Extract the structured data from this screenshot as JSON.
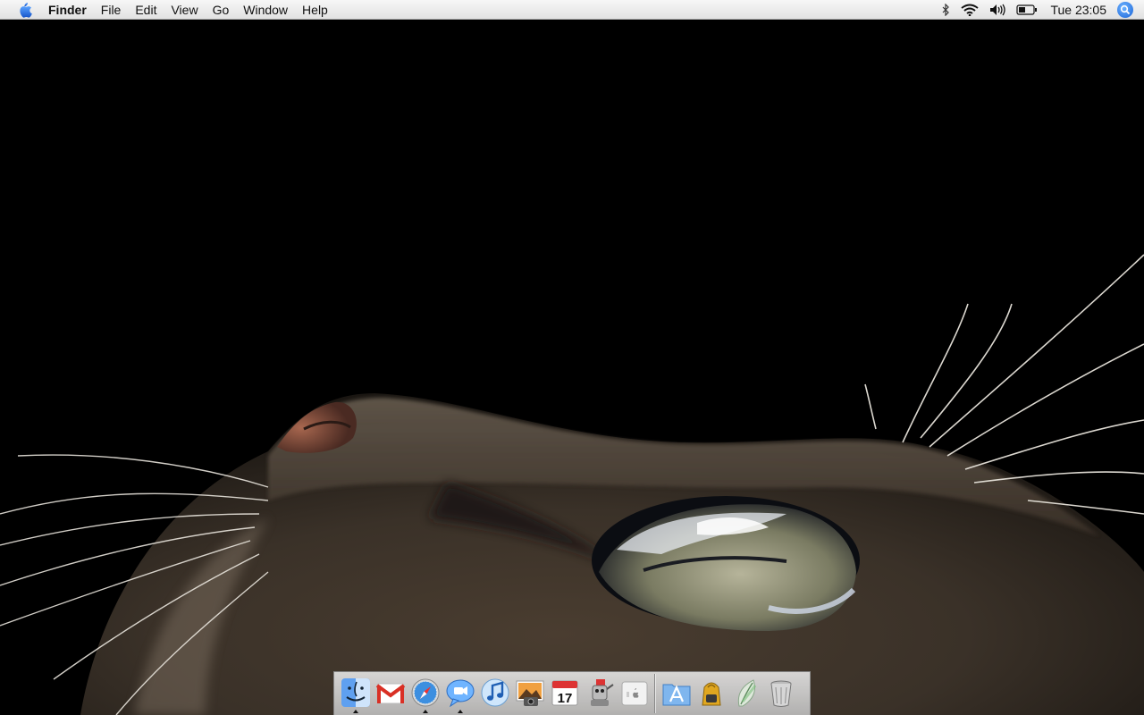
{
  "menubar": {
    "apple_icon": "apple-icon",
    "app_name": "Finder",
    "menus": [
      "File",
      "Edit",
      "View",
      "Go",
      "Window",
      "Help"
    ],
    "status_icons": [
      "bluetooth-icon",
      "wifi-icon",
      "volume-icon",
      "battery-icon"
    ],
    "clock": "Tue 23:05",
    "spotlight_icon": "spotlight-search-icon"
  },
  "desktop": {
    "wallpaper": "cat-looking-up-photo"
  },
  "dock": {
    "apps": [
      {
        "icon": "finder-icon",
        "running": true
      },
      {
        "icon": "gmail-icon",
        "running": false
      },
      {
        "icon": "safari-icon",
        "running": true
      },
      {
        "icon": "ichat-icon",
        "running": true
      },
      {
        "icon": "itunes-icon",
        "running": false
      },
      {
        "icon": "iphoto-icon",
        "running": false
      },
      {
        "icon": "ical-icon",
        "running": false,
        "date": "17"
      },
      {
        "icon": "automator-icon",
        "running": false
      },
      {
        "icon": "apple-store-icon",
        "running": false
      }
    ],
    "others": [
      {
        "icon": "applications-folder-icon"
      },
      {
        "icon": "backpack-icon"
      },
      {
        "icon": "leaf-icon"
      },
      {
        "icon": "trash-icon"
      }
    ]
  }
}
